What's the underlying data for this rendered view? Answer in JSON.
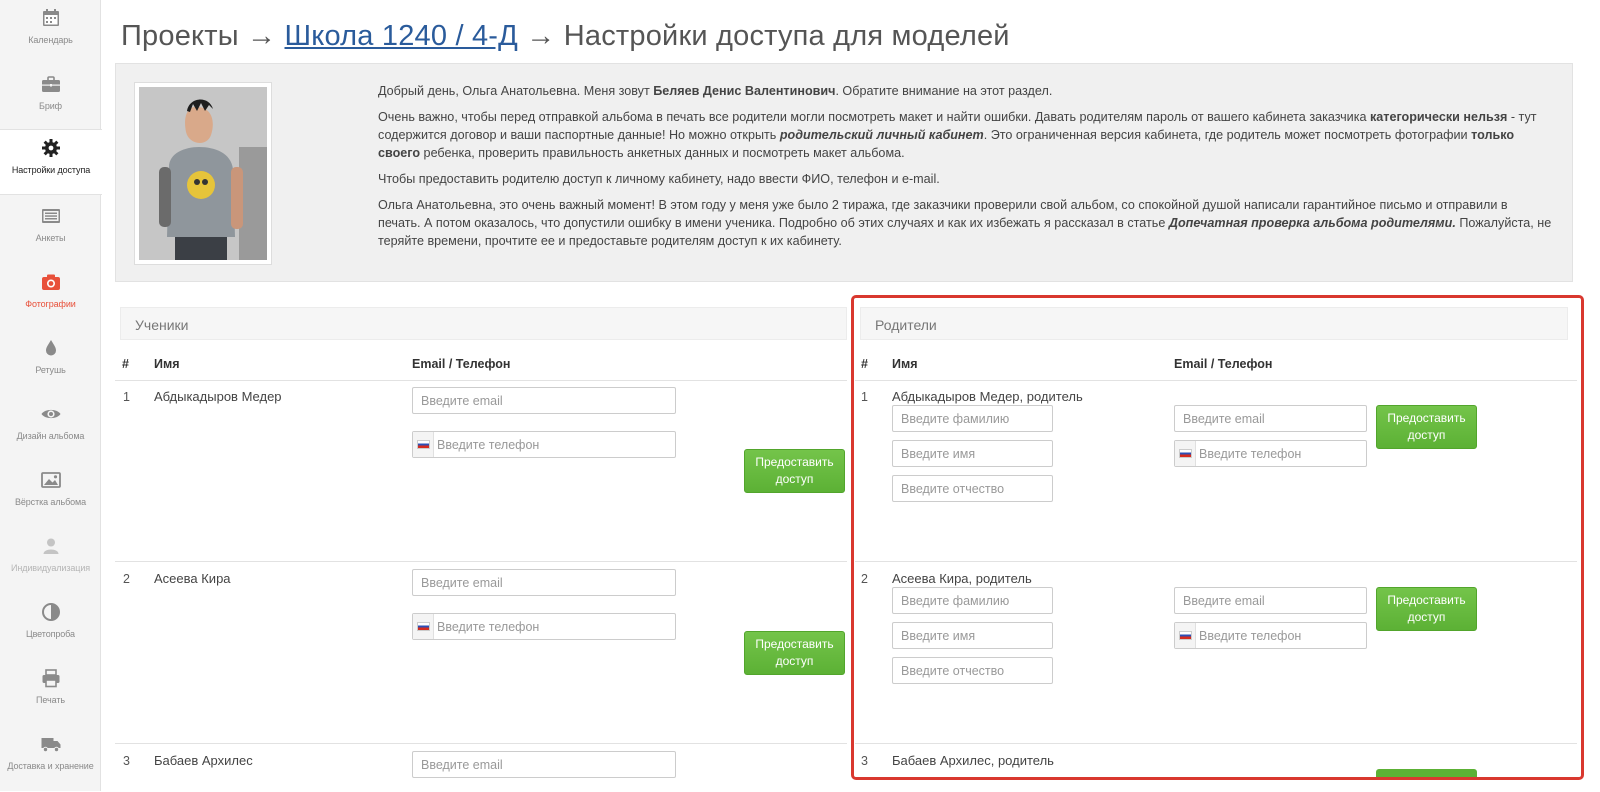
{
  "sidebar": {
    "items": [
      {
        "label": "Календарь",
        "icon": "calendar-icon"
      },
      {
        "label": "Бриф",
        "icon": "briefcase-icon"
      },
      {
        "label": "Настройки доступа",
        "icon": "gear-icon"
      },
      {
        "label": "Анкеты",
        "icon": "list-icon"
      },
      {
        "label": "Фотографии",
        "icon": "camera-icon"
      },
      {
        "label": "Ретушь",
        "icon": "drop-icon"
      },
      {
        "label": "Дизайн альбома",
        "icon": "eye-icon"
      },
      {
        "label": "Вёрстка альбома",
        "icon": "image-icon"
      },
      {
        "label": "Индивидуализация",
        "icon": "user-icon"
      },
      {
        "label": "Цветопроба",
        "icon": "contrast-icon"
      },
      {
        "label": "Печать",
        "icon": "printer-icon"
      },
      {
        "label": "Доставка и хранение",
        "icon": "truck-icon"
      }
    ],
    "active_color": "#222222",
    "accent_color": "#e8503a"
  },
  "header": {
    "prefix": "Проекты →",
    "link": "Школа 1240 / 4-Д",
    "suffix": "→ Настройки доступа для моделей"
  },
  "info": {
    "p1_a": "Добрый день, Ольга Анатольевна. Меня зовут ",
    "p1_b": "Беляев Денис Валентинович",
    "p1_c": ". Обратите внимание на этот раздел.",
    "p2_a": "Очень важно, чтобы перед отправкой альбома в печать все родители могли посмотреть макет и найти ошибки. Давать родителям пароль от вашего кабинета заказчика ",
    "p2_b": "категорически нельзя",
    "p2_c": " - тут содержится договор и ваши паспортные данные! Но можно открыть ",
    "p2_d": "родительский личный кабинет",
    "p2_e": ". Это ограниченная версия кабинета, где родитель может посмотреть фотографии ",
    "p2_f": "только своего",
    "p2_g": " ребенка, проверить правильность анкетных данных и посмотреть макет альбома.",
    "p3": "Чтобы предоставить родителю доступ к личному кабинету, надо ввести ФИО, телефон и e-mail.",
    "p4_a": "Ольга Анатольевна, это очень важный момент! В этом году у меня уже было 2 тиража, где заказчики проверили свой альбом, со спокойной душой написали гарантийное письмо и отправили в печать. А потом оказалось, что допустили ошибку в имени ученика. Подробно об этих случаях и как их избежать я рассказал в статье ",
    "p4_b": "Допечатная проверка альбома родителями.",
    "p4_c": " Пожалуйста, не теряйте времени, прочтите ее и предоставьте родителям доступ к их кабинету."
  },
  "students": {
    "title": "Ученики",
    "col_num": "#",
    "col_name": "Имя",
    "col_contact": "Email / Телефон",
    "email_placeholder": "Введите email",
    "phone_placeholder": "Введите телефон",
    "button": "Предоставить доступ",
    "rows": [
      {
        "num": "1",
        "name": "Абдыкадыров Медер"
      },
      {
        "num": "2",
        "name": "Асеева Кира"
      },
      {
        "num": "3",
        "name": "Бабаев Архилес"
      }
    ]
  },
  "parents": {
    "title": "Родители",
    "col_num": "#",
    "col_name": "Имя",
    "col_contact": "Email / Телефон",
    "surname_placeholder": "Введите фамилию",
    "firstname_placeholder": "Введите имя",
    "patronymic_placeholder": "Введите отчество",
    "email_placeholder": "Введите email",
    "phone_placeholder": "Введите телефон",
    "button": "Предоставить доступ",
    "rows": [
      {
        "num": "1",
        "name": "Абдыкадыров Медер, родитель"
      },
      {
        "num": "2",
        "name": "Асеева Кира, родитель"
      },
      {
        "num": "3",
        "name": "Бабаев Архилес, родитель"
      }
    ]
  },
  "colors": {
    "button_green": "#5cb135",
    "link_blue": "#2a5b9b",
    "highlight_red": "#d9382f"
  }
}
